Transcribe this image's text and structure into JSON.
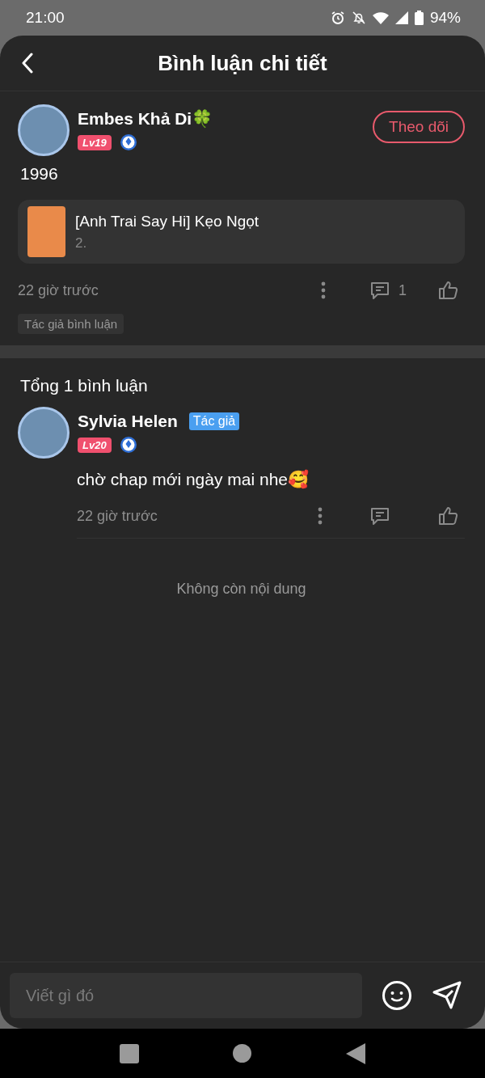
{
  "status_bar": {
    "time": "21:00",
    "battery": "94%"
  },
  "header": {
    "title": "Bình luận chi tiết"
  },
  "post": {
    "author": "Embes Khả Di🍀",
    "level": "Lv19",
    "follow_button": "Theo dõi",
    "text": "1996",
    "book": {
      "title": "[Anh Trai Say Hi] Kẹo Ngọt",
      "subtitle": "2."
    },
    "time": "22 giờ trước",
    "reply_count": "1",
    "tag": "Tác giả bình luận"
  },
  "comments_header": "Tổng 1 bình luận",
  "comments": [
    {
      "author": "Sylvia Helen",
      "badge": "Tác giả",
      "level": "Lv20",
      "text": "chờ chap mới ngày mai nhe🥰",
      "time": "22 giờ trước"
    }
  ],
  "end_text": "Không còn nội dung",
  "composer": {
    "placeholder": "Viết gì đó"
  }
}
